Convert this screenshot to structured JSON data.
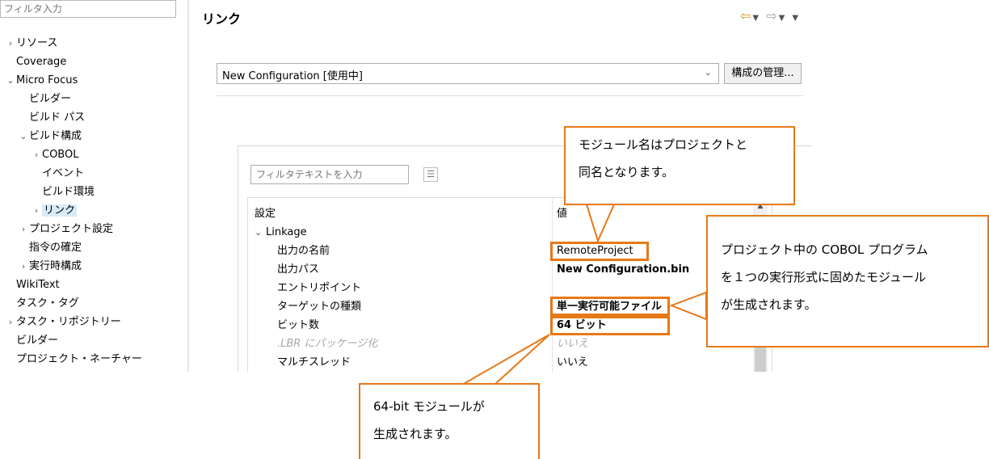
{
  "filter_input": {
    "placeholder": "フィルタ入力"
  },
  "tree": [
    {
      "label": "リソース",
      "chevron": "›",
      "indent": 1
    },
    {
      "label": "Coverage",
      "chevron": "",
      "indent": 1
    },
    {
      "label": "Micro Focus",
      "chevron": "⌄",
      "indent": 1
    },
    {
      "label": "ビルダー",
      "chevron": "",
      "indent": 2
    },
    {
      "label": "ビルド パス",
      "chevron": "",
      "indent": 2
    },
    {
      "label": "ビルド構成",
      "chevron": "⌄",
      "indent": 2
    },
    {
      "label": "COBOL",
      "chevron": "›",
      "indent": 3
    },
    {
      "label": "イベント",
      "chevron": "",
      "indent": 3
    },
    {
      "label": "ビルド環境",
      "chevron": "",
      "indent": 3
    },
    {
      "label": "リンク",
      "chevron": "›",
      "indent": 3,
      "selected": true
    },
    {
      "label": "プロジェクト設定",
      "chevron": "›",
      "indent": 2
    },
    {
      "label": "指令の確定",
      "chevron": "",
      "indent": 2
    },
    {
      "label": "実行時構成",
      "chevron": "›",
      "indent": 2
    },
    {
      "label": "WikiText",
      "chevron": "",
      "indent": 1
    },
    {
      "label": "タスク・タグ",
      "chevron": "",
      "indent": 1
    },
    {
      "label": "タスク・リポジトリー",
      "chevron": "›",
      "indent": 1
    },
    {
      "label": "ビルダー",
      "chevron": "",
      "indent": 1
    },
    {
      "label": "プロジェクト・ネーチャー",
      "chevron": "",
      "indent": 1
    }
  ],
  "page_title": "リンク",
  "config": {
    "selected": "New Configuration  [使用中]",
    "manage_label": "構成の管理..."
  },
  "filter_text": {
    "placeholder": "フィルタテキストを入力"
  },
  "table": {
    "header_setting": "設定",
    "header_value": "値",
    "group": "Linkage",
    "rows": [
      {
        "setting": "出力の名前",
        "value": "RemoteProject",
        "bold": false
      },
      {
        "setting": "出力パス",
        "value": "New Configuration.bin",
        "bold": true
      },
      {
        "setting": "エントリポイント",
        "value": "",
        "bold": false
      },
      {
        "setting": "ターゲットの種類",
        "value": "単一実行可能ファイル",
        "bold": true
      },
      {
        "setting": "ビット数",
        "value": "64 ビット",
        "bold": true
      },
      {
        "setting": ".LBR にパッケージ化",
        "value": "いいえ",
        "disabled": true
      },
      {
        "setting": "マルチスレッド",
        "value": "いいえ",
        "bold": false
      }
    ]
  },
  "callouts": {
    "module_name": [
      "モジュール名はプロジェクトと",
      "同名となります。"
    ],
    "executable": [
      "プロジェクト中の COBOL プログラム",
      "を１つの実行形式に固めたモジュール",
      "が生成されます。"
    ],
    "bitness": [
      "64-bit モジュールが",
      "生成されます。"
    ]
  },
  "colors": {
    "callout_border": "#e77817",
    "selection": "#d9ebf9"
  }
}
